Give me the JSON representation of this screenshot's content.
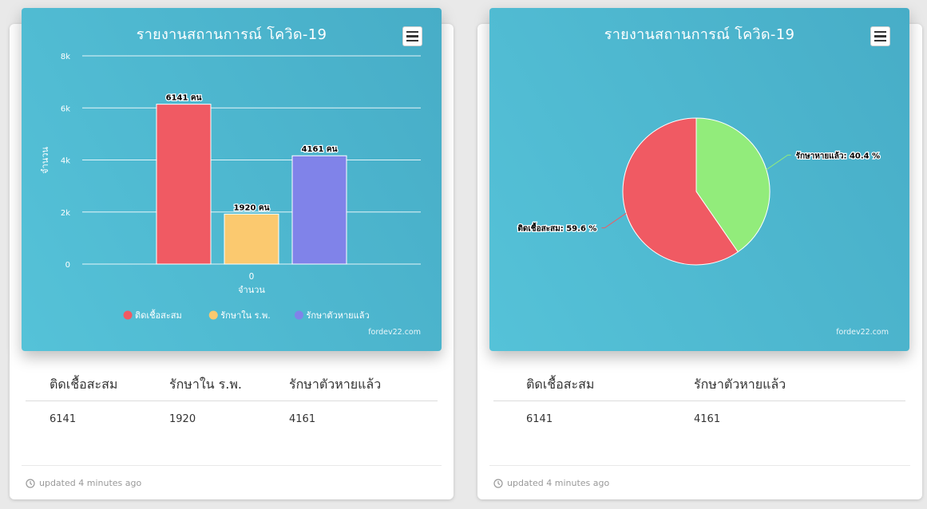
{
  "cards": [
    {
      "title": "รายงานสถานการณ์ โควิด-19",
      "credit": "fordev22.com",
      "columns": [
        "ติดเชื้อสะสม",
        "รักษาใน ร.พ.",
        "รักษาตัวหายแล้ว"
      ],
      "values": [
        "6141",
        "1920",
        "4161"
      ],
      "updated": "updated 4 minutes ago"
    },
    {
      "title": "รายงานสถานการณ์ โควิด-19",
      "credit": "fordev22.com",
      "columns": [
        "ติดเชื้อสะสม",
        "รักษาตัวหายแล้ว"
      ],
      "values": [
        "6141",
        "4161"
      ],
      "updated": "updated 4 minutes ago"
    }
  ],
  "chart_data": [
    {
      "type": "bar",
      "title": "รายงานสถานการณ์ โควิด-19",
      "categories": [
        "0"
      ],
      "xlabel": "จำนวน",
      "ylabel": "จำนวน",
      "ylim": [
        0,
        8000
      ],
      "yticks": [
        "0",
        "2k",
        "4k",
        "6k",
        "8k"
      ],
      "grid": true,
      "legend_position": "bottom",
      "series": [
        {
          "name": "ติดเชื้อสะสม",
          "values": [
            6141
          ],
          "color": "#f05a63",
          "label": "6141 คน"
        },
        {
          "name": "รักษาใน ร.พ.",
          "values": [
            1920
          ],
          "color": "#fbc96f",
          "label": "1920 คน"
        },
        {
          "name": "รักษาตัวหายแล้ว",
          "values": [
            4161
          ],
          "color": "#8083e9",
          "label": "4161 คน"
        }
      ]
    },
    {
      "type": "pie",
      "title": "รายงานสถานการณ์ โควิด-19",
      "slices": [
        {
          "label": "รักษาหายแล้ว: 40.4 %",
          "value": 40.4,
          "color": "#92ec7b"
        },
        {
          "label": "ติดเชื้อสะสม: 59.6 %",
          "value": 59.6,
          "color": "#f05a63"
        }
      ]
    }
  ]
}
